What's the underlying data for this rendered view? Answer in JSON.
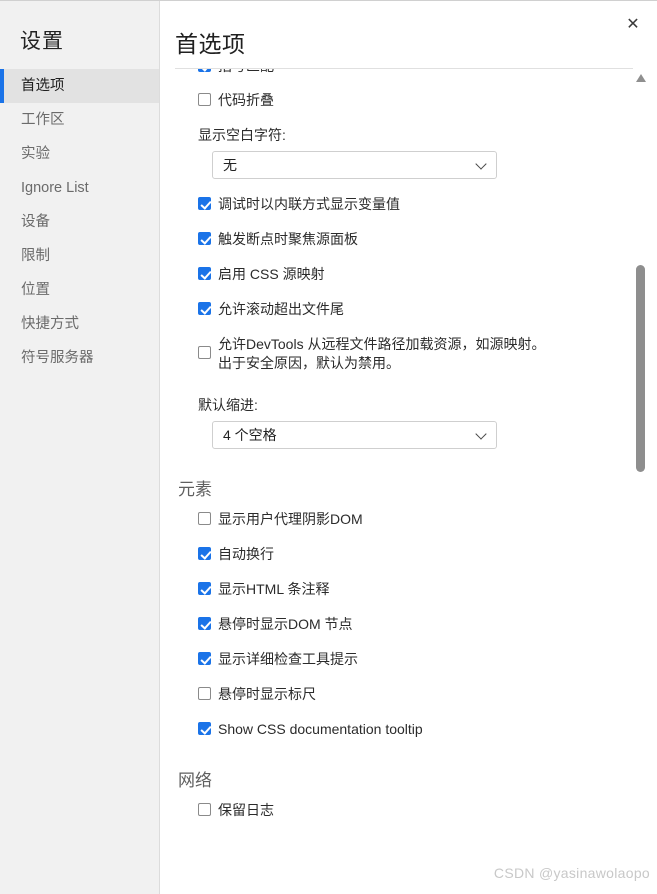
{
  "sidebar": {
    "title": "设置",
    "items": [
      {
        "label": "首选项",
        "selected": true
      },
      {
        "label": "工作区",
        "selected": false
      },
      {
        "label": "实验",
        "selected": false
      },
      {
        "label": "Ignore List",
        "selected": false
      },
      {
        "label": "设备",
        "selected": false
      },
      {
        "label": "限制",
        "selected": false
      },
      {
        "label": "位置",
        "selected": false
      },
      {
        "label": "快捷方式",
        "selected": false
      },
      {
        "label": "符号服务器",
        "selected": false
      }
    ]
  },
  "header": {
    "title": "首选项",
    "close_label": "✕"
  },
  "content": {
    "clipped_row": {
      "label": "括号匹配",
      "checked": true
    },
    "sources_rows_top": [
      {
        "label": "代码折叠",
        "checked": false
      }
    ],
    "whitespace_field": {
      "label": "显示空白字符:",
      "value": "无"
    },
    "sources_rows_mid": [
      {
        "label": "调试时以内联方式显示变量值",
        "checked": true
      },
      {
        "label": "触发断点时聚焦源面板",
        "checked": true
      },
      {
        "label": "启用 CSS 源映射",
        "checked": true
      },
      {
        "label": "允许滚动超出文件尾",
        "checked": true
      }
    ],
    "devtools_remote_row": {
      "label": "允许DevTools 从远程文件路径加载资源，如源映射。出于安全原因，默认为禁用。",
      "checked": false
    },
    "indent_field": {
      "label": "默认缩进:",
      "value": "4 个空格"
    },
    "elements_section": {
      "title": "元素",
      "rows": [
        {
          "label": "显示用户代理阴影DOM",
          "checked": false
        },
        {
          "label": "自动换行",
          "checked": true
        },
        {
          "label": "显示HTML 条注释",
          "checked": true
        },
        {
          "label": "悬停时显示DOM 节点",
          "checked": true
        },
        {
          "label": "显示详细检查工具提示",
          "checked": true
        },
        {
          "label": "悬停时显示标尺",
          "checked": false
        },
        {
          "label": "Show CSS documentation tooltip",
          "checked": true
        }
      ]
    },
    "network_section": {
      "title": "网络",
      "rows": [
        {
          "label": "保留日志",
          "checked": false
        }
      ]
    }
  },
  "scrollbar": {
    "up_arrow": "scroll-up"
  },
  "watermark": "CSDN @yasinawolaopo",
  "colors": {
    "accent": "#1a73e8",
    "sidebar_bg": "#f1f1f1",
    "sidebar_selected_bg": "#e2e2e2"
  }
}
